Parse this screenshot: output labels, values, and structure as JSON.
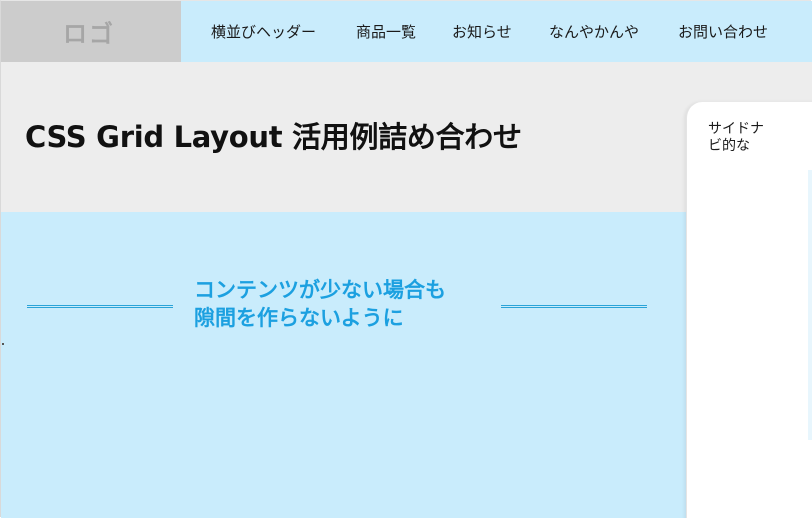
{
  "header": {
    "logo_text": "ロゴ",
    "nav_items": [
      {
        "label": "横並びヘッダー"
      },
      {
        "label": "商品一覧"
      },
      {
        "label": "お知らせ"
      },
      {
        "label": "なんやかんや"
      },
      {
        "label": "お問い合わせ"
      }
    ]
  },
  "main": {
    "title": "CSS Grid Layout 活用例詰め合わせ",
    "message_line1": "コンテンツが少ない場合も",
    "message_line2": "隙間を作らないように"
  },
  "sidebar": {
    "text": "サイドナビ的な"
  },
  "colors": {
    "logo_bg": "#cccccc",
    "nav_bg": "#c9ecfc",
    "title_bg": "#ededed",
    "content_bg": "#c9ecfc",
    "accent": "#1ca0e0"
  }
}
